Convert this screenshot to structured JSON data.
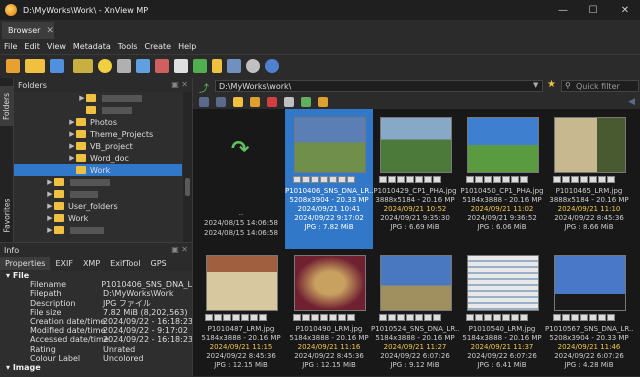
{
  "window": {
    "title": "D:\\MyWorks\\Work\\ - XnView MP"
  },
  "tabs": [
    {
      "label": "Browser"
    }
  ],
  "menu": [
    "File",
    "Edit",
    "View",
    "Metadata",
    "Tools",
    "Create",
    "Help"
  ],
  "left_vertical_tabs": [
    "Folders",
    "Favorites"
  ],
  "folders": {
    "title": "Folders",
    "items": [
      {
        "label": "Photos",
        "selected": false
      },
      {
        "label": "Theme_Projects",
        "selected": false
      },
      {
        "label": "VB_project",
        "selected": false
      },
      {
        "label": "Word_doc",
        "selected": false
      },
      {
        "label": "Work",
        "selected": true
      },
      {
        "label": "User_folders",
        "selected": false
      },
      {
        "label": "Work",
        "selected": false
      }
    ]
  },
  "info": {
    "title": "Info",
    "tabs": [
      "Properties",
      "EXIF",
      "XMP",
      "ExifTool",
      "GPS"
    ],
    "sections": [
      {
        "name": "File",
        "rows": [
          {
            "k": "Filename",
            "v": "P1010406_SNS_DNA_L"
          },
          {
            "k": "Filepath",
            "v": "D:\\MyWorks\\Work"
          },
          {
            "k": "Description",
            "v": "JPG ファイル"
          },
          {
            "k": "File size",
            "v": "7.82 MiB (8,202,563)"
          },
          {
            "k": "Creation date/time",
            "v": "2024/09/22 - 16:18:23"
          },
          {
            "k": "Modified date/time",
            "v": "2024/09/22 - 9:17:02"
          },
          {
            "k": "Accessed date/time",
            "v": "2024/09/22 - 16:18:23"
          },
          {
            "k": "Rating",
            "v": "Unrated"
          },
          {
            "k": "Colour Label",
            "v": "Uncolored"
          }
        ]
      },
      {
        "name": "Image",
        "rows": []
      }
    ]
  },
  "browser": {
    "path": "D:\\MyWorks\\work\\",
    "filter_placeholder": "Quick filter",
    "parent_cell": {
      "name": "..",
      "line2": "2024/08/15 14:06:58",
      "line3": "2024/08/15 14:06:58"
    },
    "files": [
      {
        "name": "P1010406_SNS_DNA_LR...",
        "dims": "5208x3904 - 20.33 MP",
        "date": "2024/09/21 10:41",
        "modified": "2024/09/22 9:17:02",
        "size": "JPG : 7.82 MiB",
        "selected": true,
        "colors": [
          "#5b7fb5",
          "#6f8f4a"
        ]
      },
      {
        "name": "P1010429_CP1_PHA.jpg",
        "dims": "3888x5184 - 20.16 MP",
        "date": "2024/09/21 10:52",
        "modified": "2024/09/21 9:35:30",
        "size": "JPG : 6.69 MiB",
        "selected": false,
        "colors": [
          "#88a8c8",
          "#4c7a3a"
        ]
      },
      {
        "name": "P1010450_CP1_PHA.jpg",
        "dims": "5184x3888 - 20.16 MP",
        "date": "2024/09/21 11:02",
        "modified": "2024/09/21 9:36:52",
        "size": "JPG : 6.06 MiB",
        "selected": false,
        "colors": [
          "#3f7fd0",
          "#5a9a40"
        ]
      },
      {
        "name": "P1010465_LRM.jpg",
        "dims": "3888x5184 - 20.16 MP",
        "date": "2024/09/21 11:10",
        "modified": "2024/09/22 8:45:36",
        "size": "JPG : 8.66 MiB",
        "selected": false,
        "colors": [
          "#c8b890",
          "#4a5a30"
        ]
      },
      {
        "name": "P1010487_LRM.jpg",
        "dims": "5184x3888 - 20.16 MP",
        "date": "2024/09/21 11:15",
        "modified": "2024/09/22 8:45:36",
        "size": "JPG : 12.15 MiB",
        "selected": false,
        "colors": [
          "#a06040",
          "#d8c8a0"
        ]
      },
      {
        "name": "P1010490_LRM.jpg",
        "dims": "5184x3888 - 20.16 MP",
        "date": "2024/09/21 11:16",
        "modified": "2024/09/22 8:45:36",
        "size": "JPG : 12.15 MiB",
        "selected": false,
        "colors": [
          "#702030",
          "#c8a060"
        ]
      },
      {
        "name": "P1010524_SNS_DNA_LR...",
        "dims": "5184x3888 - 20.16 MP",
        "date": "2024/09/21 11:27",
        "modified": "2024/09/22 6:07:26",
        "size": "JPG : 9.12 MiB",
        "selected": false,
        "colors": [
          "#4a78c0",
          "#a09060"
        ]
      },
      {
        "name": "P1010540_LRM.jpg",
        "dims": "5184x3888 - 20.16 MP",
        "date": "2024/09/21 11:37",
        "modified": "2024/09/22 6:07:26",
        "size": "JPG : 6.41 MiB",
        "selected": false,
        "colors": [
          "#9ab0c8",
          "#e8e8e8"
        ]
      },
      {
        "name": "P1010567_SNS_DNA_LR...",
        "dims": "5208x3904 - 20.33 MP",
        "date": "2024/09/21 11:46",
        "modified": "2024/09/22 6:07:26",
        "size": "JPG : 4.28 MiB",
        "selected": false,
        "colors": [
          "#4a78c8",
          "#1a1a1a"
        ]
      }
    ]
  },
  "colors": {
    "selection": "#3278c8",
    "date_text": "#f0c84a",
    "folder": "#f0c040"
  }
}
